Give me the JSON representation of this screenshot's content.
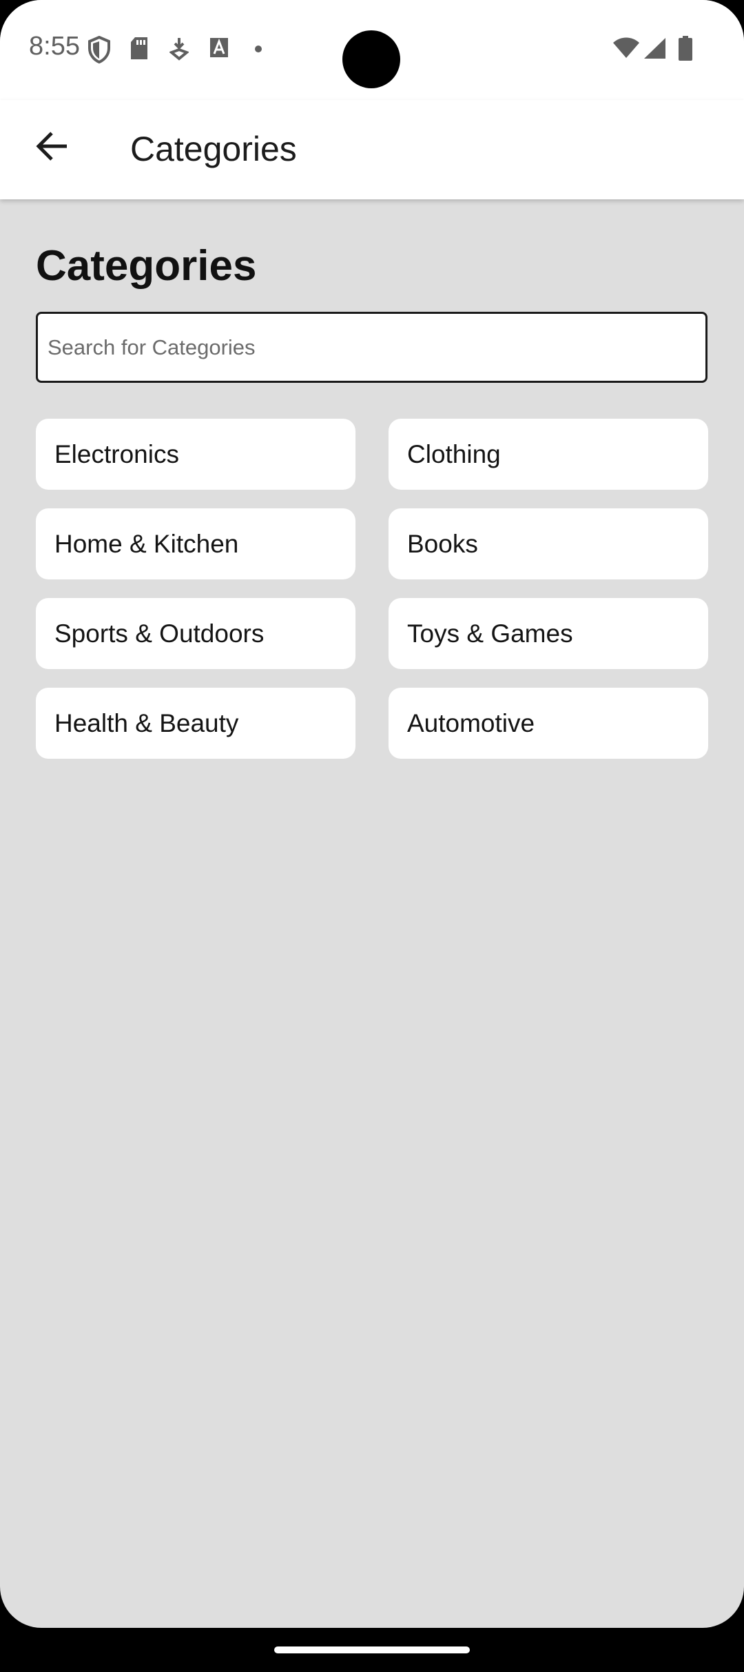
{
  "status_bar": {
    "time": "8:55",
    "left_icons": [
      "shield-icon",
      "sd-card-icon",
      "download-icon",
      "font-icon",
      "dot-icon"
    ],
    "right_icons": [
      "wifi-icon",
      "signal-icon",
      "battery-icon"
    ]
  },
  "app_bar": {
    "back_icon": "arrow-back-icon",
    "title": "Categories"
  },
  "main": {
    "heading": "Categories",
    "search": {
      "placeholder": "Search for Categories",
      "value": ""
    },
    "categories": [
      "Electronics",
      "Clothing",
      "Home & Kitchen",
      "Books",
      "Sports & Outdoors",
      "Toys & Games",
      "Health & Beauty",
      "Automotive"
    ]
  },
  "colors": {
    "background": "#dedede",
    "card": "#ffffff",
    "text": "#141414"
  }
}
